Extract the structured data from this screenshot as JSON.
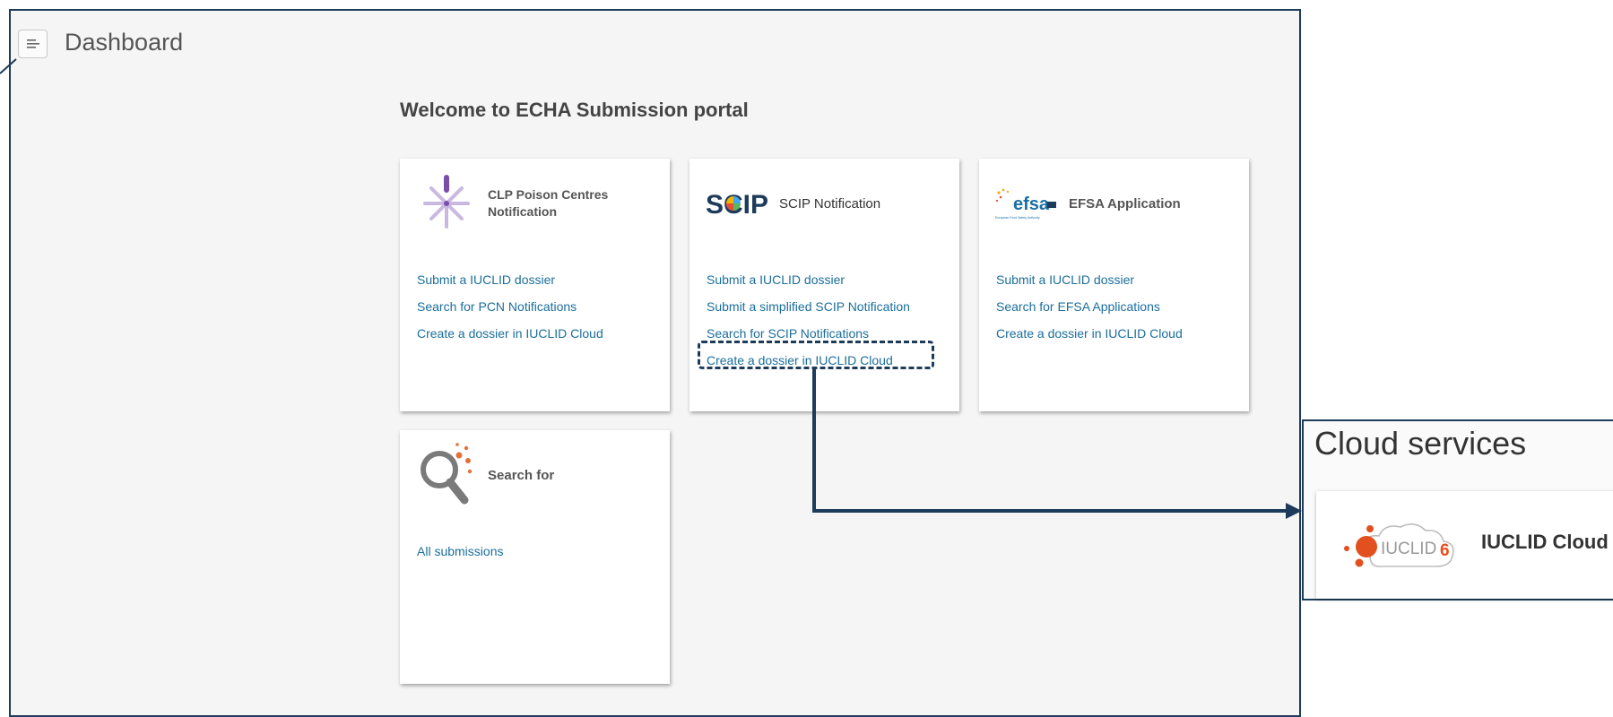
{
  "header": {
    "title": "Dashboard"
  },
  "welcome": "Welcome to ECHA Submission portal",
  "cards": [
    {
      "title": "CLP Poison Centres Notification",
      "links": [
        "Submit a IUCLID dossier",
        "Search for PCN Notifications",
        "Create a dossier in IUCLID Cloud"
      ]
    },
    {
      "logo_text": "SCIP",
      "title": "SCIP Notification",
      "links": [
        "Submit a IUCLID dossier",
        "Submit a simplified SCIP Notification",
        "Search for SCIP Notifications",
        "Create a dossier in IUCLID Cloud"
      ]
    },
    {
      "logo_text": "efsa",
      "logo_subtext": "European Food Safety Authority",
      "title": "EFSA Application",
      "links": [
        "Submit a IUCLID dossier",
        "Search for EFSA Applications",
        "Create a dossier in IUCLID Cloud"
      ]
    },
    {
      "title": "Search for",
      "links": [
        "All submissions"
      ]
    }
  ],
  "cloud": {
    "title": "Cloud services",
    "item_label": "IUCLID Cloud",
    "logo_text": "IUCLID",
    "logo_number": "6"
  },
  "colors": {
    "accent": "#1d3b5a",
    "link": "#1b6e9b"
  },
  "icons": [
    "menu-icon",
    "poison-centre-icon",
    "scip-logo",
    "efsa-logo",
    "search-magnifier-icon",
    "iuclid-logo"
  ]
}
